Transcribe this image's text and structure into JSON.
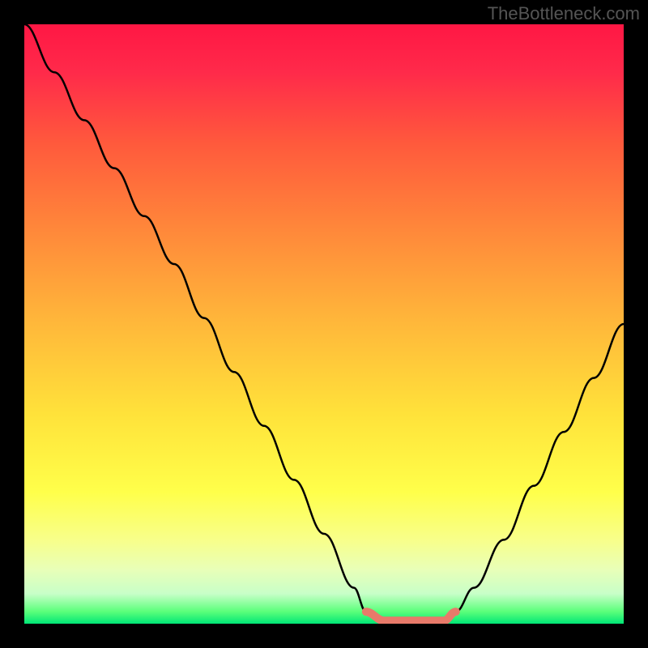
{
  "watermark": "TheBottleneck.com",
  "chart_data": {
    "type": "line",
    "title": "",
    "xlabel": "",
    "ylabel": "",
    "xlim": [
      0,
      100
    ],
    "ylim": [
      0,
      100
    ],
    "gradient_stops": [
      {
        "pos": 0,
        "color": "#ff1744"
      },
      {
        "pos": 8,
        "color": "#ff2a4a"
      },
      {
        "pos": 20,
        "color": "#ff5a3c"
      },
      {
        "pos": 35,
        "color": "#ff8a3a"
      },
      {
        "pos": 50,
        "color": "#ffb83a"
      },
      {
        "pos": 65,
        "color": "#ffe23a"
      },
      {
        "pos": 78,
        "color": "#ffff4a"
      },
      {
        "pos": 86,
        "color": "#f8ff8a"
      },
      {
        "pos": 91,
        "color": "#e8ffb8"
      },
      {
        "pos": 95,
        "color": "#c8ffc8"
      },
      {
        "pos": 98,
        "color": "#5aff7a"
      },
      {
        "pos": 100,
        "color": "#00e676"
      }
    ],
    "series": [
      {
        "name": "bottleneck-curve",
        "color": "#000000",
        "x": [
          0,
          5,
          10,
          15,
          20,
          25,
          30,
          35,
          40,
          45,
          50,
          55,
          57,
          60,
          65,
          70,
          72,
          75,
          80,
          85,
          90,
          95,
          100
        ],
        "y": [
          100,
          92,
          84,
          76,
          68,
          60,
          51,
          42,
          33,
          24,
          15,
          6,
          2,
          0.5,
          0.5,
          0.5,
          2,
          6,
          14,
          23,
          32,
          41,
          50
        ]
      },
      {
        "name": "optimal-zone-marker",
        "color": "#e87a6a",
        "x": [
          57,
          60,
          65,
          70,
          72
        ],
        "y": [
          2,
          0.5,
          0.5,
          0.5,
          2
        ]
      }
    ],
    "annotations": []
  }
}
